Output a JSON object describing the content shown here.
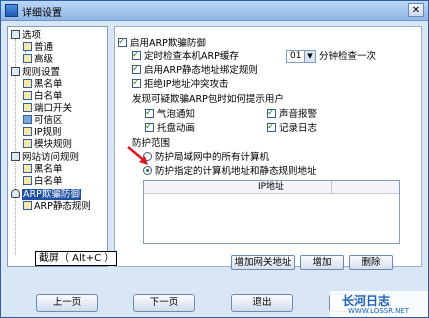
{
  "window": {
    "title": "详细设置",
    "close_glyph": "✕"
  },
  "tree": {
    "items": [
      {
        "label": "选项",
        "level": 0,
        "icon": "options-icon"
      },
      {
        "label": "普通",
        "level": 1,
        "icon": "general-icon"
      },
      {
        "label": "高级",
        "level": 1,
        "icon": "advanced-icon"
      },
      {
        "label": "规则设置",
        "level": 0,
        "icon": "rules-icon"
      },
      {
        "label": "黑名单",
        "level": 1,
        "icon": "blacklist-icon"
      },
      {
        "label": "白名单",
        "level": 1,
        "icon": "whitelist-icon"
      },
      {
        "label": "端口开关",
        "level": 1,
        "icon": "port-switch-icon"
      },
      {
        "label": "可信区",
        "level": 1,
        "icon": "trusted-zone-icon"
      },
      {
        "label": "IP规则",
        "level": 1,
        "icon": "ip-rule-icon"
      },
      {
        "label": "模块规则",
        "level": 1,
        "icon": "module-rule-icon"
      },
      {
        "label": "网站访问规则",
        "level": 0,
        "icon": "website-rules-icon"
      },
      {
        "label": "黑名单",
        "level": 1,
        "icon": "site-blacklist-icon"
      },
      {
        "label": "白名单",
        "level": 1,
        "icon": "site-whitelist-icon"
      },
      {
        "label": "ARP欺骗防御",
        "level": 0,
        "icon": "arp-defense-icon",
        "selected": true
      },
      {
        "label": "ARP静态规则",
        "level": 1,
        "icon": "arp-static-icon"
      }
    ]
  },
  "main": {
    "enable_arp": "启用ARP欺骗防御",
    "check_cache": "定时检查本机ARP缓存",
    "interval_value": "01",
    "interval_suffix": "分钟检查一次",
    "enable_static": "启用ARP静态地址绑定规则",
    "reject_ip_conflict": "拒绝IP地址冲突攻击",
    "notify_title": "发现可疑欺骗ARP包时如何提示用户",
    "notify_bubble": "气泡通知",
    "notify_sound": "声音报警",
    "notify_tray": "托盘动画",
    "notify_log": "记录日志",
    "protect_title": "防护范围",
    "protect_all": "防护局域网中的所有计算机",
    "protect_specified": "防护指定的计算机地址和静态规则地址",
    "table_header": "IP地址",
    "btn_add_gateway": "增加网关地址",
    "btn_add": "增加",
    "btn_delete": "删除"
  },
  "footer": {
    "prev": "上一页",
    "next": "下一页",
    "exit": "退出",
    "help": "帮助"
  },
  "overlay": {
    "shortcut_tip": "截屏（ Alt+C ）",
    "watermark": "长河日志",
    "watermark_url": "WWW.LOSSR.NET"
  }
}
